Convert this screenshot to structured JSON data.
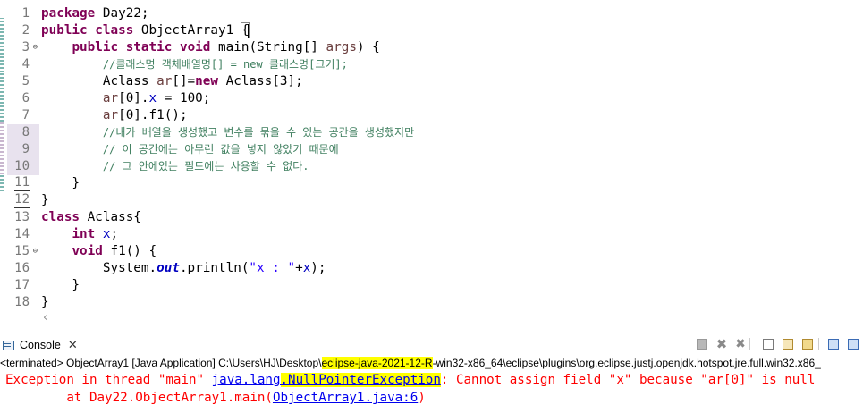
{
  "editor": {
    "lines": [
      {
        "num": "1",
        "segs": [
          {
            "t": "package",
            "c": "kw"
          },
          {
            "t": " Day22;"
          }
        ]
      },
      {
        "num": "2",
        "segs": [
          {
            "t": "public",
            "c": "kw"
          },
          {
            "t": " "
          },
          {
            "t": "class",
            "c": "kw"
          },
          {
            "t": " ObjectArray1 "
          },
          {
            "t": "{",
            "c": "bracket"
          }
        ]
      },
      {
        "num": "3",
        "fold": "⊖",
        "segs": [
          {
            "t": "    "
          },
          {
            "t": "public",
            "c": "kw"
          },
          {
            "t": " "
          },
          {
            "t": "static",
            "c": "kw"
          },
          {
            "t": " "
          },
          {
            "t": "void",
            "c": "kw"
          },
          {
            "t": " main(String[] "
          },
          {
            "t": "args",
            "c": "pm"
          },
          {
            "t": ") {"
          }
        ]
      },
      {
        "num": "4",
        "segs": [
          {
            "t": "        "
          },
          {
            "t": "//클래스명 객체배열명[] = new 클래스명[크기];",
            "c": "cm"
          }
        ]
      },
      {
        "num": "5",
        "segs": [
          {
            "t": "        Aclass "
          },
          {
            "t": "ar",
            "c": "pm"
          },
          {
            "t": "[]="
          },
          {
            "t": "new",
            "c": "kw"
          },
          {
            "t": " Aclass[3];"
          }
        ]
      },
      {
        "num": "6",
        "segs": [
          {
            "t": "        "
          },
          {
            "t": "ar",
            "c": "pm"
          },
          {
            "t": "[0]."
          },
          {
            "t": "x",
            "c": "fld"
          },
          {
            "t": " = 100;"
          }
        ]
      },
      {
        "num": "7",
        "segs": [
          {
            "t": "        "
          },
          {
            "t": "ar",
            "c": "pm"
          },
          {
            "t": "[0].f1();"
          }
        ]
      },
      {
        "num": "8",
        "hl": true,
        "segs": [
          {
            "t": "        "
          },
          {
            "t": "//내가 배열을 생성했고 변수를 묶을 수 있는 공간을 생성했지만",
            "c": "cm"
          }
        ]
      },
      {
        "num": "9",
        "hl": true,
        "segs": [
          {
            "t": "        "
          },
          {
            "t": "// 이 공간에는 아무런 값을 넣지 않았기 때문에",
            "c": "cm"
          }
        ]
      },
      {
        "num": "10",
        "hl": true,
        "segs": [
          {
            "t": "        "
          },
          {
            "t": "// 그 안에있는 필드에는 사용할 수 없다.",
            "c": "cm"
          }
        ]
      },
      {
        "num": "11",
        "u": true,
        "segs": [
          {
            "t": "    }"
          }
        ]
      },
      {
        "num": "12",
        "u": true,
        "segs": [
          {
            "t": "}"
          }
        ]
      },
      {
        "num": "13",
        "segs": [
          {
            "t": "class",
            "c": "kw"
          },
          {
            "t": " Aclass{"
          }
        ]
      },
      {
        "num": "14",
        "segs": [
          {
            "t": "    "
          },
          {
            "t": "int",
            "c": "kw"
          },
          {
            "t": " "
          },
          {
            "t": "x",
            "c": "fld"
          },
          {
            "t": ";"
          }
        ]
      },
      {
        "num": "15",
        "fold": "⊖",
        "segs": [
          {
            "t": "    "
          },
          {
            "t": "void",
            "c": "kw"
          },
          {
            "t": " f1() {"
          }
        ]
      },
      {
        "num": "16",
        "segs": [
          {
            "t": "        System."
          },
          {
            "t": "out",
            "c": "fldi"
          },
          {
            "t": ".println("
          },
          {
            "t": "\"x : \"",
            "c": "str"
          },
          {
            "t": "+"
          },
          {
            "t": "x",
            "c": "fld"
          },
          {
            "t": ");"
          }
        ]
      },
      {
        "num": "17",
        "segs": [
          {
            "t": "    }"
          }
        ]
      },
      {
        "num": "18",
        "segs": [
          {
            "t": "}"
          }
        ]
      }
    ],
    "scroll_left_icon": "chevron-left-icon"
  },
  "console": {
    "tab_label": "Console",
    "tab_icon": "console-icon",
    "close_icon": "close-icon",
    "launch_pre": "<terminated> ObjectArray1 [Java Application] C:\\Users\\HJ\\Desktop\\",
    "launch_hl": "eclipse-java-2021-12-R",
    "launch_post": "-win32-x86_64\\eclipse\\plugins\\org.eclipse.justj.openjdk.hotspot.jre.full.win32.x86_",
    "out1_pre": "Exception in thread \"main\" ",
    "out1_link_a": "java.lang",
    "out1_link_b": ".NullPointerException",
    "out1_post": ": Cannot assign field \"x\" because \"ar[0]\" is null",
    "out2_pre": "        at Day22.ObjectArray1.main(",
    "out2_link": "ObjectArray1.java:6",
    "out2_post": ")",
    "toolbar_icons": [
      "terminate-icon",
      "remove-launch-icon",
      "remove-all-launches-icon",
      "scroll-lock-icon",
      "word-wrap-icon",
      "clear-console-icon",
      "pin-console-icon",
      "display-selected-console-icon",
      "open-console-icon"
    ]
  },
  "colors": {
    "keyword": "#7f0055",
    "comment": "#3f7f5f",
    "field": "#0000c0",
    "string": "#2a00ff",
    "error": "#ff0000",
    "link": "#0000ee",
    "highlight": "#ffff00"
  }
}
